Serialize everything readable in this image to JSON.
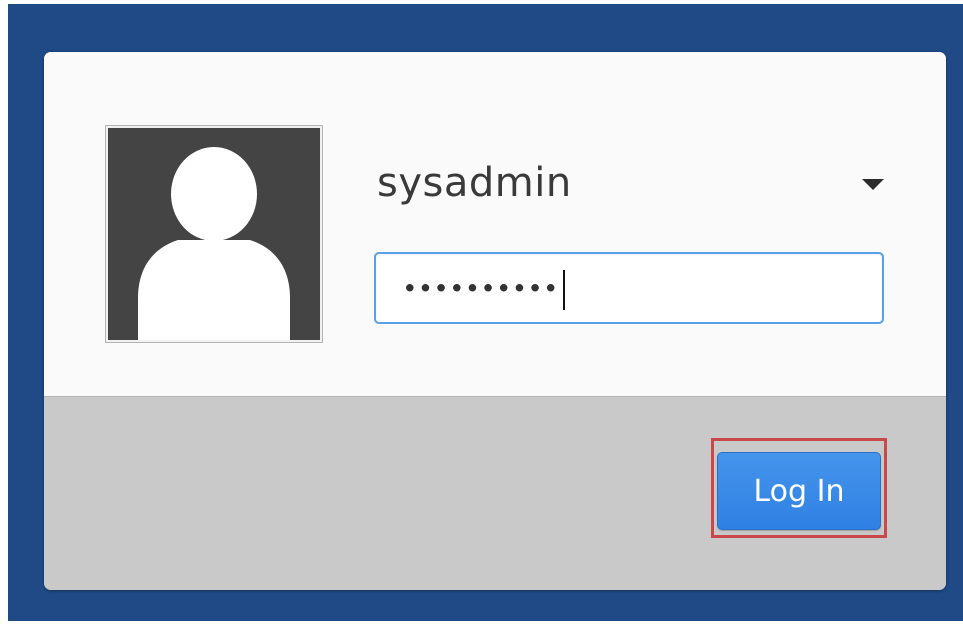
{
  "login_dialog": {
    "username": "sysadmin",
    "password_masked": "••••••••••",
    "login_button_label": "Log In"
  },
  "colors": {
    "background": "#1f4a86",
    "button_accent": "#3a8ae8",
    "focus_border": "#5aa0e8",
    "highlight_box": "#c9484a"
  },
  "icons": {
    "avatar": "user-silhouette-icon",
    "username_dropdown": "chevron-down-icon"
  }
}
